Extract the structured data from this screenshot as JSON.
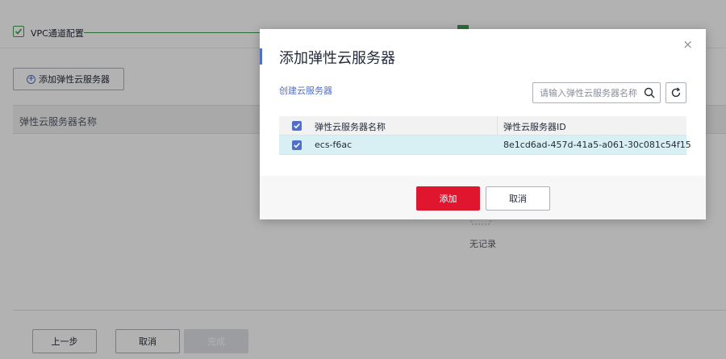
{
  "background": {
    "steps": [
      {
        "label": "VPC通道配置",
        "done": true
      }
    ],
    "add_button_label": "添加弹性云服务器",
    "table": {
      "columns": [
        "弹性云服务器名称"
      ]
    },
    "empty_text": "无记录",
    "footer": {
      "prev_label": "上一步",
      "cancel_label": "取消",
      "done_label": "完成"
    }
  },
  "modal": {
    "title": "添加弹性云服务器",
    "close_symbol": "×",
    "create_link": "创建云服务器",
    "search": {
      "placeholder": "请输入弹性云服务器名称",
      "value": ""
    },
    "table": {
      "columns": [
        "弹性云服务器名称",
        "弹性云服务器ID"
      ],
      "rows": [
        {
          "name": "ecs-f6ac",
          "id": "8e1cd6ad-457d-41a5-a061-30c081c54f15",
          "checked": true
        }
      ]
    },
    "footer": {
      "add_label": "添加",
      "cancel_label": "取消"
    }
  },
  "colors": {
    "accent": "#526ecc",
    "primary_button": "#e0162f",
    "success": "#3d9c4e",
    "selected_row": "#d8f0f4"
  },
  "icons": [
    "check-icon",
    "plus-circle-icon",
    "close-icon",
    "search-icon",
    "refresh-icon",
    "empty-box-icon"
  ]
}
